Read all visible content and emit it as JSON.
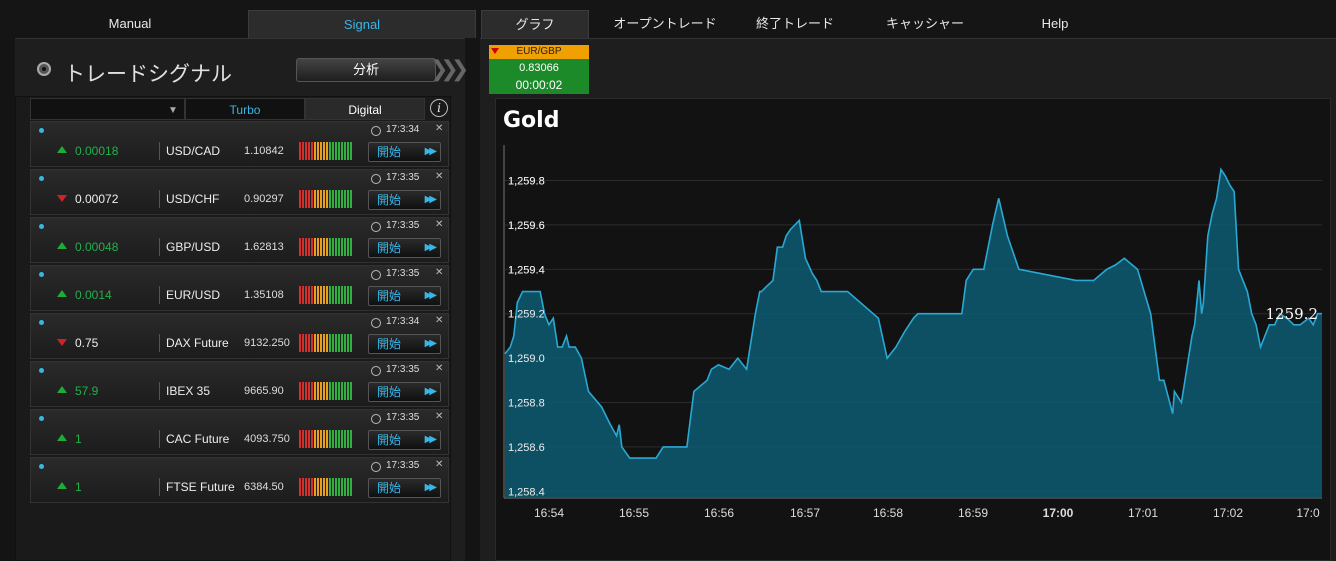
{
  "nav": {
    "tabs": [
      {
        "label": "Manual"
      },
      {
        "label": "Signal"
      },
      {
        "label": "グラフ"
      },
      {
        "label": "オープントレード"
      },
      {
        "label": "終了トレード"
      },
      {
        "label": "キャッシャー"
      },
      {
        "label": "Help"
      }
    ]
  },
  "signal_panel": {
    "title": "トレードシグナル",
    "analyze_label": "分析",
    "subtabs": {
      "turbo": "Turbo",
      "digital": "Digital"
    },
    "start_label": "開始",
    "rows": [
      {
        "change": "0.00018",
        "direction": "up",
        "symbol": "USD/CAD",
        "price": "1.10842",
        "time": "17:3:34"
      },
      {
        "change": "0.00072",
        "direction": "down",
        "symbol": "USD/CHF",
        "price": "0.90297",
        "time": "17:3:35"
      },
      {
        "change": "0.00048",
        "direction": "up",
        "symbol": "GBP/USD",
        "price": "1.62813",
        "time": "17:3:35"
      },
      {
        "change": "0.0014",
        "direction": "up",
        "symbol": "EUR/USD",
        "price": "1.35108",
        "time": "17:3:35"
      },
      {
        "change": "0.75",
        "direction": "down",
        "symbol": "DAX Future",
        "price": "9132.250",
        "time": "17:3:34"
      },
      {
        "change": "57.9",
        "direction": "up",
        "symbol": "IBEX 35",
        "price": "9665.90",
        "time": "17:3:35"
      },
      {
        "change": "1",
        "direction": "up",
        "symbol": "CAC Future",
        "price": "4093.750",
        "time": "17:3:35"
      },
      {
        "change": "1",
        "direction": "up",
        "symbol": "FTSE Future",
        "price": "6384.50",
        "time": "17:3:35"
      }
    ]
  },
  "ticker": {
    "pair": "EUR/GBP",
    "value": "0.83066",
    "timer": "00:00:02",
    "direction": "down"
  },
  "chart": {
    "title": "Gold",
    "current_label": "1259.2"
  },
  "chart_data": {
    "type": "area",
    "title": "Gold",
    "color": "#2aa8d4",
    "xlabels": [
      "16:54",
      "16:55",
      "16:56",
      "16:57",
      "16:58",
      "16:59",
      "17:00",
      "17:01",
      "17:02",
      "17:0"
    ],
    "ylabels": [
      "1,259.8",
      "1,259.6",
      "1,259.4",
      "1,259.2",
      "1,259.0",
      "1,258.8",
      "1,258.6",
      "1,258.4"
    ],
    "ylim": [
      1258.37,
      1259.96
    ],
    "xlim": [
      0,
      9.3
    ],
    "x": [
      0,
      0.06,
      0.1,
      0.14,
      0.2,
      0.23,
      0.26,
      0.3,
      0.36,
      0.4,
      0.45,
      0.5,
      0.55,
      0.6,
      0.65,
      0.7,
      0.73,
      0.76,
      0.8,
      0.87,
      0.95,
      1.1,
      1.2,
      1.27,
      1.3,
      1.33,
      1.42,
      1.55,
      1.62,
      1.72,
      1.8,
      2.07,
      2.15,
      2.3,
      2.35,
      2.43,
      2.55,
      2.65,
      2.75,
      2.85,
      2.9,
      2.92,
      2.97,
      3.05,
      3.1,
      3.16,
      3.2,
      3.25,
      3.35,
      3.42,
      3.5,
      3.55,
      3.6,
      3.9,
      4.25,
      4.35,
      4.45,
      4.55,
      4.65,
      4.7,
      4.75,
      4.8,
      4.85,
      4.9,
      4.95,
      5.0,
      5.05,
      5.1,
      5.15,
      5.2,
      5.25,
      5.33,
      5.45,
      5.55,
      5.62,
      5.72,
      5.85,
      6.5,
      6.7,
      6.85,
      6.95,
      7.05,
      7.2,
      7.35,
      7.45,
      7.5,
      7.6,
      7.62,
      7.7,
      7.78,
      7.82,
      7.85,
      7.9,
      7.93,
      7.95,
      8.0,
      8.05,
      8.1,
      8.15,
      8.2,
      8.25,
      8.3,
      8.35,
      8.4,
      8.45,
      8.5,
      8.55,
      8.6,
      8.65,
      8.7,
      8.76,
      8.82,
      8.9,
      8.98,
      9.05,
      9.15,
      9.2,
      9.25,
      9.3
    ],
    "y": [
      1259.02,
      1259.05,
      1259.1,
      1259.25,
      1259.3,
      1259.3,
      1259.3,
      1259.3,
      1259.3,
      1259.3,
      1259.2,
      1259.15,
      1259.18,
      1259.05,
      1259.05,
      1259.1,
      1259.05,
      1259.05,
      1259.05,
      1259.0,
      1258.85,
      1258.78,
      1258.7,
      1258.65,
      1258.7,
      1258.6,
      1258.55,
      1258.55,
      1258.55,
      1258.55,
      1258.6,
      1258.6,
      1258.85,
      1258.9,
      1258.95,
      1258.97,
      1258.95,
      1259.0,
      1258.95,
      1259.2,
      1259.3,
      1259.3,
      1259.32,
      1259.35,
      1259.5,
      1259.5,
      1259.55,
      1259.58,
      1259.62,
      1259.45,
      1259.38,
      1259.35,
      1259.3,
      1259.3,
      1259.18,
      1259.0,
      1259.05,
      1259.12,
      1259.18,
      1259.2,
      1259.2,
      1259.2,
      1259.2,
      1259.2,
      1259.2,
      1259.2,
      1259.2,
      1259.2,
      1259.2,
      1259.2,
      1259.35,
      1259.4,
      1259.4,
      1259.6,
      1259.72,
      1259.55,
      1259.4,
      1259.35,
      1259.35,
      1259.4,
      1259.42,
      1259.45,
      1259.4,
      1259.2,
      1258.9,
      1258.9,
      1258.75,
      1258.85,
      1258.8,
      1259.0,
      1259.1,
      1259.15,
      1259.35,
      1259.2,
      1259.25,
      1259.55,
      1259.65,
      1259.72,
      1259.85,
      1259.82,
      1259.78,
      1259.75,
      1259.4,
      1259.35,
      1259.3,
      1259.2,
      1259.15,
      1259.05,
      1259.1,
      1259.15,
      1259.15,
      1259.2,
      1259.18,
      1259.15,
      1259.15,
      1259.18,
      1259.15,
      1259.2,
      1259.2
    ],
    "grid": true,
    "last_value": "1259.2"
  }
}
